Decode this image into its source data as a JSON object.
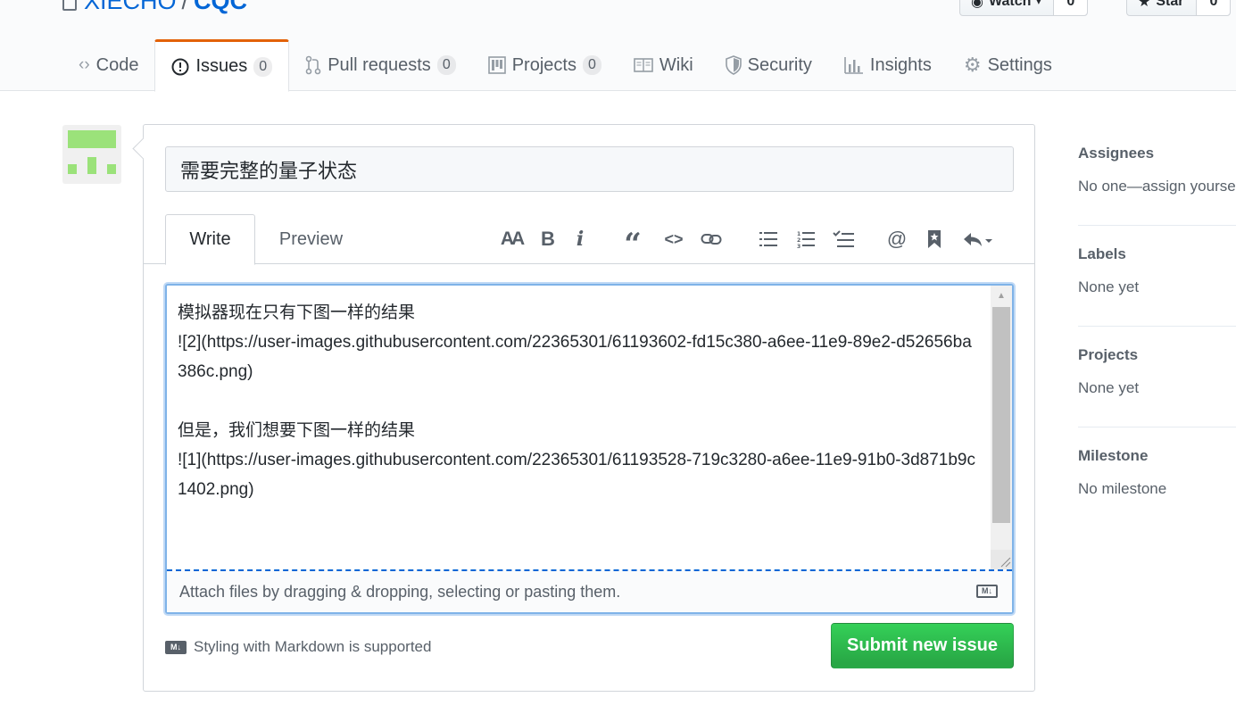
{
  "repo": {
    "owner": "XIECHO",
    "separator": "/",
    "name": "CQC"
  },
  "header_buttons": {
    "watch": {
      "label": "Watch",
      "count": "0"
    },
    "star": {
      "label": "Star",
      "count": "0"
    }
  },
  "nav_tabs": [
    {
      "label": "Code",
      "icon": "code-icon"
    },
    {
      "label": "Issues",
      "count": "0",
      "icon": "issue-opened-icon",
      "selected": true
    },
    {
      "label": "Pull requests",
      "count": "0",
      "icon": "git-pull-request-icon"
    },
    {
      "label": "Projects",
      "count": "0",
      "icon": "project-icon"
    },
    {
      "label": "Wiki",
      "icon": "book-icon"
    },
    {
      "label": "Security",
      "icon": "shield-icon"
    },
    {
      "label": "Insights",
      "icon": "graph-icon"
    },
    {
      "label": "Settings",
      "icon": "gear-icon"
    }
  ],
  "issue_form": {
    "title_value": "需要完整的量子状态",
    "tabs": {
      "write": "Write",
      "preview": "Preview"
    },
    "toolbar": {
      "header": "AA",
      "bold": "B",
      "italic": "i",
      "quote": "“",
      "code": "<>",
      "link": "link-icon",
      "unordered_list": "list-unordered-icon",
      "ordered_list": "list-ordered-icon",
      "task_list": "tasklist-icon",
      "mention": "@",
      "saved_reply": "bookmark-icon",
      "reply": "reply-icon"
    },
    "body_value": "模拟器现在只有下图一样的结果\n![2](https://user-images.githubusercontent.com/22365301/61193602-fd15c380-a6ee-11e9-89e2-d52656ba386c.png)\n\n但是，我们想要下图一样的结果\n![1](https://user-images.githubusercontent.com/22365301/61193528-719c3280-a6ee-11e9-91b0-3d871b9c1402.png)",
    "attach_hint": "Attach files by dragging & dropping, selecting or pasting them.",
    "markdown_note": "Styling with Markdown is supported",
    "markdown_badge": "M↓",
    "submit_label": "Submit new issue"
  },
  "sidebar": [
    {
      "heading": "Assignees",
      "value": "No one—assign yourself"
    },
    {
      "heading": "Labels",
      "value": "None yet"
    },
    {
      "heading": "Projects",
      "value": "None yet"
    },
    {
      "heading": "Milestone",
      "value": "No milestone"
    }
  ],
  "colors": {
    "accent_tab": "#e36209",
    "link": "#0366d6",
    "submit": "#28a745",
    "avatar_identicon": "#9be27a"
  }
}
